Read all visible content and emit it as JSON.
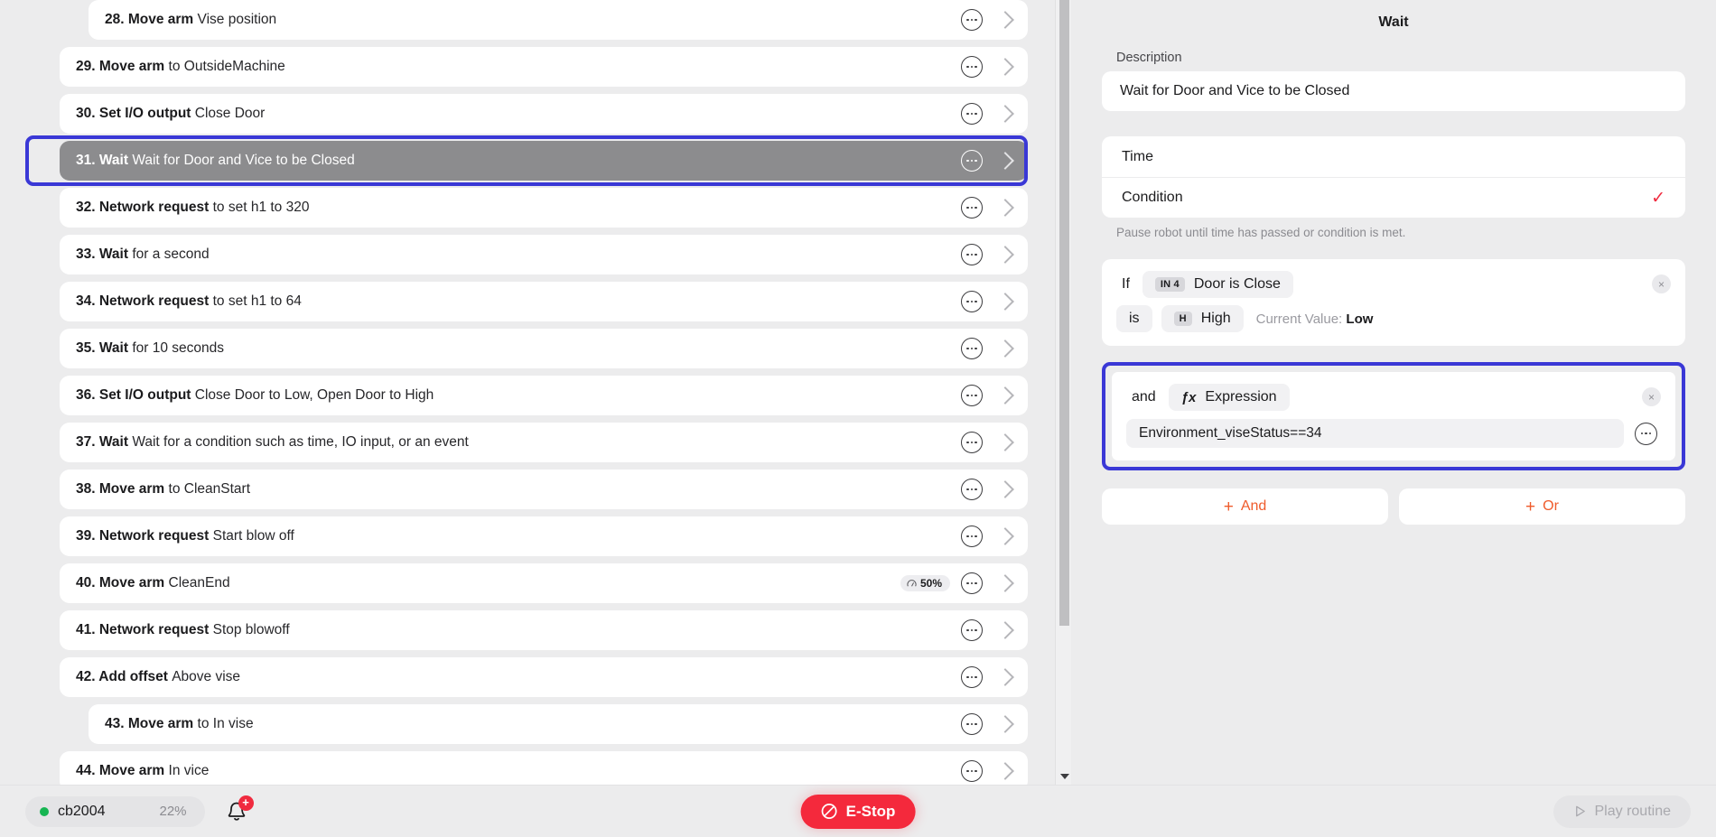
{
  "routine": {
    "steps": [
      {
        "num": "28.",
        "action": "Move arm",
        "detail": "Vise position",
        "indent": 1,
        "selected": false,
        "speed": ""
      },
      {
        "num": "29.",
        "action": "Move arm",
        "detail": "to OutsideMachine",
        "indent": 0,
        "selected": false,
        "speed": ""
      },
      {
        "num": "30.",
        "action": "Set I/O output",
        "detail": "Close Door",
        "indent": 0,
        "selected": false,
        "speed": ""
      },
      {
        "num": "31.",
        "action": "Wait",
        "detail": "Wait for Door and Vice to be Closed",
        "indent": 0,
        "selected": true,
        "speed": ""
      },
      {
        "num": "32.",
        "action": "Network request",
        "detail": "to set h1 to 320",
        "indent": 0,
        "selected": false,
        "speed": ""
      },
      {
        "num": "33.",
        "action": "Wait",
        "detail": "for a second",
        "indent": 0,
        "selected": false,
        "speed": ""
      },
      {
        "num": "34.",
        "action": "Network request",
        "detail": "to set h1 to 64",
        "indent": 0,
        "selected": false,
        "speed": ""
      },
      {
        "num": "35.",
        "action": "Wait",
        "detail": "for 10 seconds",
        "indent": 0,
        "selected": false,
        "speed": ""
      },
      {
        "num": "36.",
        "action": "Set I/O output",
        "detail": "Close Door to Low, Open Door to High",
        "indent": 0,
        "selected": false,
        "speed": ""
      },
      {
        "num": "37.",
        "action": "Wait",
        "detail": "Wait for a condition such as time, IO input, or an event",
        "indent": 0,
        "selected": false,
        "speed": ""
      },
      {
        "num": "38.",
        "action": "Move arm",
        "detail": "to CleanStart",
        "indent": 0,
        "selected": false,
        "speed": ""
      },
      {
        "num": "39.",
        "action": "Network request",
        "detail": "Start blow off",
        "indent": 0,
        "selected": false,
        "speed": ""
      },
      {
        "num": "40.",
        "action": "Move arm",
        "detail": "CleanEnd",
        "indent": 0,
        "selected": false,
        "speed": "50%"
      },
      {
        "num": "41.",
        "action": "Network request",
        "detail": "Stop blowoff",
        "indent": 0,
        "selected": false,
        "speed": ""
      },
      {
        "num": "42.",
        "action": "Add offset",
        "detail": "Above vise",
        "indent": 0,
        "selected": false,
        "speed": ""
      },
      {
        "num": "43.",
        "action": "Move arm",
        "detail": "to In vise",
        "indent": 1,
        "selected": false,
        "speed": ""
      },
      {
        "num": "44.",
        "action": "Move arm",
        "detail": "In vice",
        "indent": 0,
        "selected": false,
        "speed": ""
      }
    ]
  },
  "detail": {
    "title": "Wait",
    "description_label": "Description",
    "description_value": "Wait for Door and Vice to be Closed",
    "modes": [
      {
        "label": "Time",
        "selected": false
      },
      {
        "label": "Condition",
        "selected": true
      }
    ],
    "check_glyph": "✓",
    "hint": "Pause robot until time has passed or condition is met.",
    "conditions": [
      {
        "keyword": "If",
        "tag": "IN 4",
        "chip_label": "Door is Close",
        "operator": "is",
        "value_tag": "H",
        "value_label": "High",
        "current_value_label": "Current Value:",
        "current_value": "Low",
        "close_glyph": "×",
        "highlighted": false
      },
      {
        "keyword": "and",
        "fx_glyph": "ƒx",
        "chip_label": "Expression",
        "expression_value": "Environment_viseStatus==34",
        "close_glyph": "×",
        "highlighted": true
      }
    ],
    "add_buttons": [
      {
        "plus": "+",
        "label": "And"
      },
      {
        "plus": "+",
        "label": "Or"
      }
    ]
  },
  "statusbar": {
    "robot_name": "cb2004",
    "battery": "22%",
    "notification_badge": "+",
    "estop_label": "E-Stop",
    "play_label": "Play routine"
  },
  "colors": {
    "accent_blue": "#3a38d6",
    "accent_orange": "#ef5b2b",
    "danger_red": "#f4293c",
    "check_red": "#f02b3f",
    "online_green": "#17b552"
  }
}
